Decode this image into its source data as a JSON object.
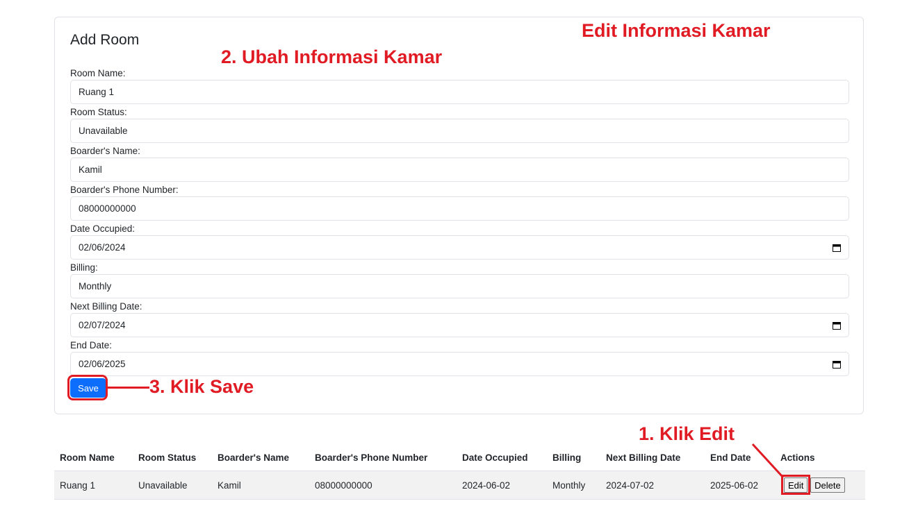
{
  "form": {
    "title": "Add Room",
    "fields": [
      {
        "label": "Room Name:",
        "value": "Ruang 1",
        "type": "text"
      },
      {
        "label": "Room Status:",
        "value": "Unavailable",
        "type": "text"
      },
      {
        "label": "Boarder's Name:",
        "value": "Kamil",
        "type": "text"
      },
      {
        "label": "Boarder's Phone Number:",
        "value": "08000000000",
        "type": "text"
      },
      {
        "label": "Date Occupied:",
        "value": "02/06/2024",
        "type": "date"
      },
      {
        "label": "Billing:",
        "value": "Monthly",
        "type": "text"
      },
      {
        "label": "Next Billing Date:",
        "value": "02/07/2024",
        "type": "date"
      },
      {
        "label": "End Date:",
        "value": "02/06/2025",
        "type": "date"
      }
    ],
    "save_label": "Save"
  },
  "table": {
    "headers": [
      "Room Name",
      "Room Status",
      "Boarder's Name",
      "Boarder's Phone Number",
      "Date Occupied",
      "Billing",
      "Next Billing Date",
      "End Date",
      "Actions"
    ],
    "rows": [
      {
        "cells": [
          "Ruang 1",
          "Unavailable",
          "Kamil",
          "08000000000",
          "2024-06-02",
          "Monthly",
          "2024-07-02",
          "2025-06-02"
        ],
        "edit_label": "Edit",
        "delete_label": "Delete"
      }
    ]
  },
  "annotations": {
    "heading": "Edit Informasi Kamar",
    "step1": "1. Klik Edit",
    "step2": "2. Ubah Informasi Kamar",
    "step3": "3. Klik Save",
    "color": "#e01b24"
  },
  "icons": {
    "date_field": "calendar-icon"
  }
}
